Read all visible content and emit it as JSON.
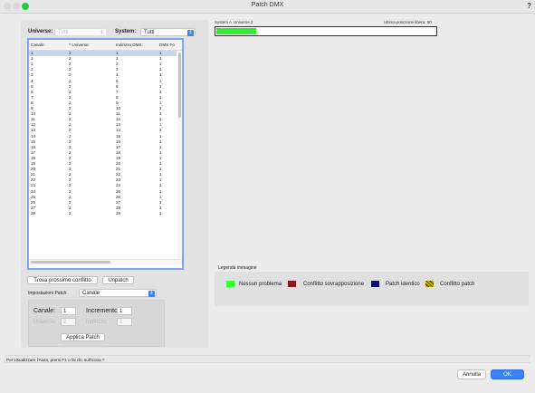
{
  "window": {
    "title": "Patch DMX",
    "help_glyph": "?",
    "traffic_colors": [
      "#d9d9d9",
      "#d9d9d9",
      "#29c940"
    ]
  },
  "filters": {
    "universe_label": "Universe:",
    "universe_value": "Tutti",
    "system_label": "System:",
    "system_value": "Tutti"
  },
  "table": {
    "columns": [
      "Canale:",
      "^  Universe:",
      "Indirizzo DMX:",
      "DMX Fo"
    ],
    "selected_row": 0,
    "rows": [
      [
        "1",
        "2",
        "1",
        "1"
      ],
      [
        "1",
        "2",
        "1",
        "1"
      ],
      [
        "1",
        "2",
        "2",
        "1"
      ],
      [
        "2",
        "2",
        "3",
        "1"
      ],
      [
        "3",
        "2",
        "4",
        "1"
      ],
      [
        "4",
        "2",
        "5",
        "1"
      ],
      [
        "5",
        "2",
        "6",
        "1"
      ],
      [
        "6",
        "2",
        "7",
        "1"
      ],
      [
        "7",
        "2",
        "8",
        "1"
      ],
      [
        "8",
        "2",
        "9",
        "1"
      ],
      [
        "9",
        "2",
        "10",
        "1"
      ],
      [
        "10",
        "2",
        "11",
        "1"
      ],
      [
        "11",
        "2",
        "12",
        "1"
      ],
      [
        "12",
        "2",
        "13",
        "1"
      ],
      [
        "13",
        "2",
        "14",
        "1"
      ],
      [
        "14",
        "2",
        "15",
        "1"
      ],
      [
        "15",
        "2",
        "16",
        "1"
      ],
      [
        "16",
        "2",
        "17",
        "1"
      ],
      [
        "17",
        "2",
        "18",
        "1"
      ],
      [
        "18",
        "2",
        "19",
        "1"
      ],
      [
        "19",
        "2",
        "20",
        "1"
      ],
      [
        "20",
        "2",
        "21",
        "1"
      ],
      [
        "21",
        "2",
        "22",
        "1"
      ],
      [
        "22",
        "2",
        "23",
        "1"
      ],
      [
        "23",
        "2",
        "24",
        "1"
      ],
      [
        "24",
        "2",
        "25",
        "1"
      ],
      [
        "25",
        "2",
        "26",
        "1"
      ],
      [
        "26",
        "2",
        "27",
        "1"
      ],
      [
        "27",
        "2",
        "28",
        "1"
      ],
      [
        "28",
        "2",
        "29",
        "1"
      ]
    ]
  },
  "buttons": {
    "find_conflict": "Trova prossimo conflitto",
    "unpatch": "Unpatch",
    "apply_patch": "Applica Patch",
    "cancel": "Annulla",
    "ok": "OK"
  },
  "patch_settings": {
    "label": "Impostazioni Patch:",
    "mode": "Canale",
    "channel_label": "Canale:",
    "channel_value": "1",
    "increment_label": "Incremento:",
    "increment_value": "1",
    "universe_label": "Universe:",
    "universe_value": "2",
    "address_label": "Indirizzo:",
    "address_value": "1"
  },
  "universe_bar": {
    "system_text": "System A",
    "universe_text": "Universe 2",
    "last_free": "Ultima posizione libera: 90",
    "fill_fraction": 0.18,
    "fill_color": "#33ee33"
  },
  "legend": {
    "title": "Legenda immagine",
    "items": [
      {
        "label": "Nessun problema",
        "color": "#33ff33"
      },
      {
        "label": "Conflitto sovrapposizione",
        "color": "#8b1a1a"
      },
      {
        "label": "Patch identico",
        "color": "#10106e"
      },
      {
        "label": "Conflitto patch",
        "color": "#c8b400"
      }
    ]
  },
  "status_text": "Per visualizzare l'Aiuto, premi F1 o fai clic sull'icona ?"
}
